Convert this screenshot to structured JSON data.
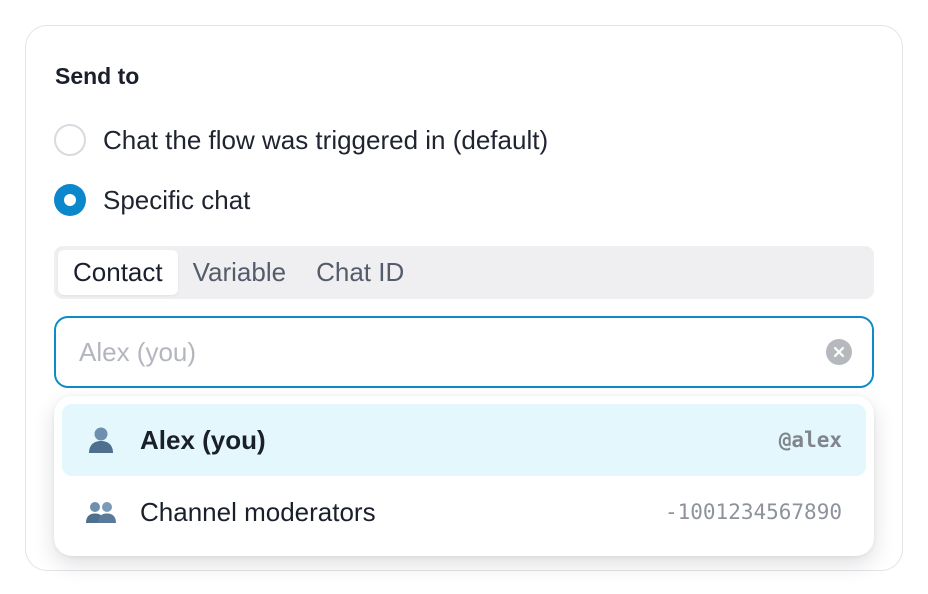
{
  "send_to": {
    "title": "Send to",
    "options": [
      {
        "label": "Chat the flow was triggered in (default)",
        "checked": false
      },
      {
        "label": "Specific chat",
        "checked": true
      }
    ]
  },
  "target_tabs": {
    "items": [
      "Contact",
      "Variable",
      "Chat ID"
    ],
    "active": "Contact"
  },
  "search": {
    "placeholder": "Alex (you)",
    "value": ""
  },
  "results": [
    {
      "icon": "user-icon",
      "label": "Alex (you)",
      "meta": "@alex",
      "highlighted": true
    },
    {
      "icon": "users-icon",
      "label": "Channel moderators",
      "meta": "-1001234567890",
      "highlighted": false
    }
  ],
  "colors": {
    "accent": "#0b87cc",
    "highlight": "#e3f7fc"
  }
}
